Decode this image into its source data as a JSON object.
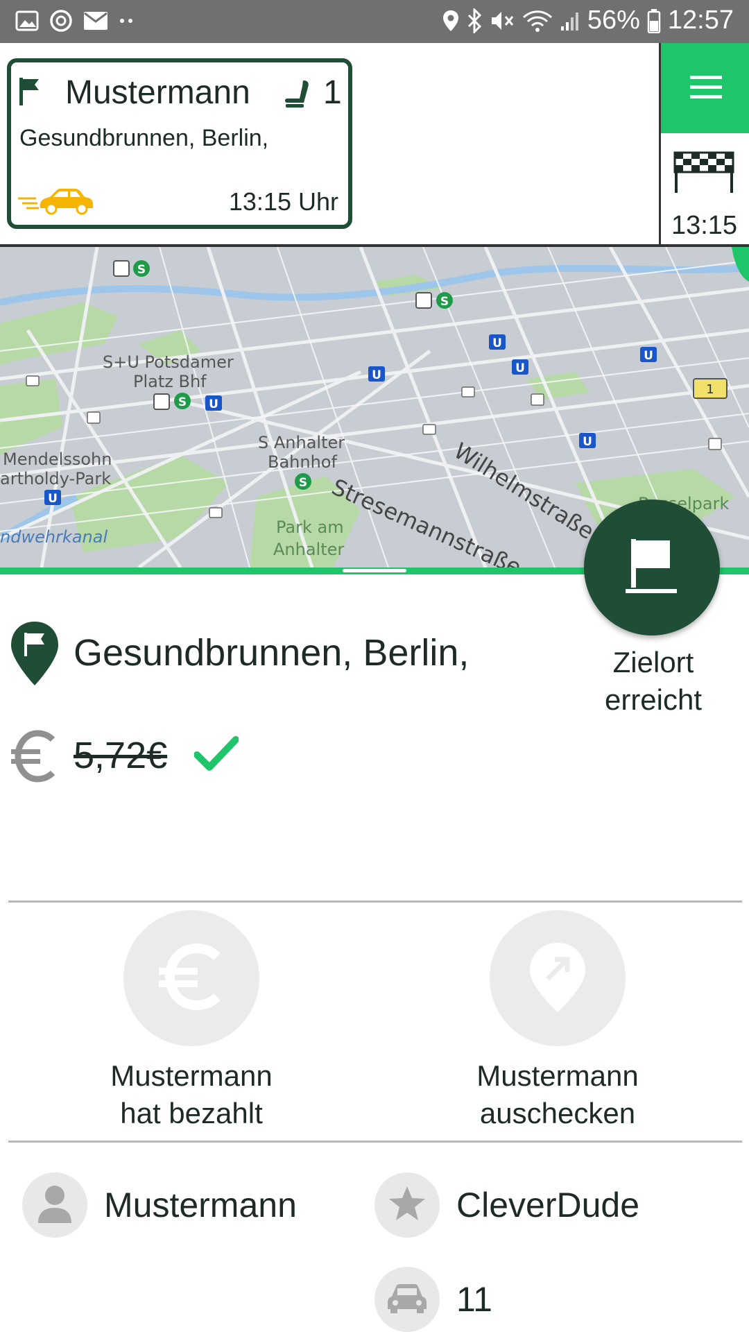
{
  "status_bar": {
    "battery": "56%",
    "time": "12:57",
    "icons": [
      "gallery-icon",
      "sync-icon",
      "mail-icon",
      "dots-icon",
      "location-icon",
      "bluetooth-icon",
      "mute-icon",
      "wifi-icon",
      "signal-icon",
      "battery-icon"
    ]
  },
  "ride_card": {
    "passenger": "Mustermann",
    "seats": "1",
    "address": "Gesundbrunnen, Berlin,",
    "time": "13:15 Uhr"
  },
  "side": {
    "finish_time": "13:15"
  },
  "map": {
    "labels": {
      "potsdamer_1": "S+U Potsdamer",
      "potsdamer_2": "Platz Bhf",
      "anhalter_1": "S Anhalter",
      "anhalter_2": "Bahnhof",
      "mendelssohn_1": "Mendelssohn",
      "mendelssohn_2": "artholdy-Park",
      "park_1": "Park am",
      "park_2": "Anhalter",
      "landwehr": "ndwehrkanal",
      "wilhelm": "Wilhelmstraße",
      "stresemann": "Stresemannstraße",
      "gesselpark": "Besselpark",
      "route_badge": "1"
    }
  },
  "fab": {
    "label_line1": "Zielort",
    "label_line2": "erreicht"
  },
  "destination": {
    "address": "Gesundbrunnen, Berlin,",
    "price": "5,72€"
  },
  "actions": {
    "paid_line1": "Mustermann",
    "paid_line2": "hat bezahlt",
    "checkout_line1": "Mustermann",
    "checkout_line2": "auschecken"
  },
  "info": {
    "passenger": "Mustermann",
    "driver": "CleverDude",
    "car": "11"
  },
  "colors": {
    "brand_green": "#1fc56a",
    "dark_green": "#1f4d36",
    "status_bar": "#707070"
  }
}
